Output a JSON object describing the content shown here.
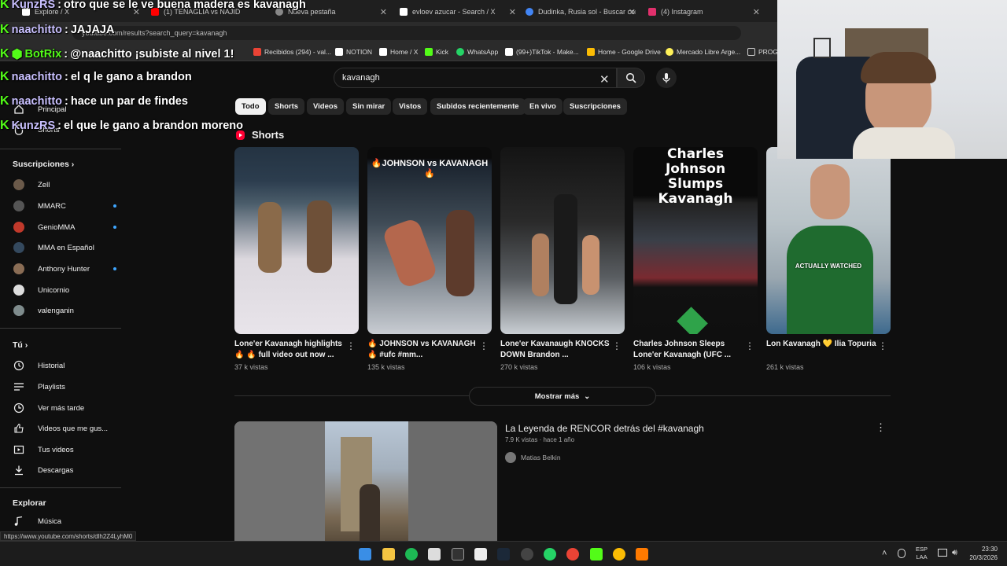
{
  "chat": [
    {
      "user": "KunzRS",
      "msg": "otro que se le ve buena madera es kavanagh"
    },
    {
      "user": "naachitto",
      "msg": "JAJAJA"
    },
    {
      "user": "BotRix",
      "msg": "@naachitto ¡subiste al nivel 1!"
    },
    {
      "user": "naachitto",
      "msg": "el q le gano a brandon"
    },
    {
      "user": "naachitto",
      "msg": "hace un par de findes"
    },
    {
      "user": "KunzRS",
      "msg": "el que le gano a brandon moreno"
    }
  ],
  "tabs": [
    {
      "label": "Explore / X",
      "color": "#ffffff"
    },
    {
      "label": "(1) TENAGLIA vs NAJID",
      "color": "#ff0000"
    },
    {
      "label": "Nueva pestaña",
      "color": "#888888"
    },
    {
      "label": "evloev azucar - Search / X",
      "color": "#ffffff"
    },
    {
      "label": "Dudinka, Rusia sol - Buscar con",
      "color": "#4285f4"
    },
    {
      "label": "(4) Instagram",
      "color": "#e1306c"
    }
  ],
  "address": "youtube.com/results?search_query=kavanagh",
  "bookmarks": [
    {
      "label": "Recibidos (294) - val...",
      "color": "#ea4335"
    },
    {
      "label": "NOTION",
      "color": "#ffffff"
    },
    {
      "label": "Home / X",
      "color": "#ffffff"
    },
    {
      "label": "Kick",
      "color": "#53fc18"
    },
    {
      "label": "WhatsApp",
      "color": "#25d366"
    },
    {
      "label": "(99+)TikTok - Make...",
      "color": "#ffffff"
    },
    {
      "label": "Home - Google Drive",
      "color": "#fbbc04"
    },
    {
      "label": "Mercado Libre Arge...",
      "color": "#fff159"
    },
    {
      "label": "PROG",
      "color": "#cccccc"
    }
  ],
  "search": {
    "value": "kavanagh"
  },
  "chips": [
    "Todo",
    "Shorts",
    "Videos",
    "Sin mirar",
    "Vistos",
    "Subidos recientemente",
    "En vivo",
    "Suscripciones"
  ],
  "sidebar": {
    "top": [
      {
        "label": "Principal"
      },
      {
        "label": "Shorts"
      }
    ],
    "subs_heading": "Suscripciones",
    "subs": [
      {
        "label": "Zell",
        "color": "#6b5a4a",
        "dot": false
      },
      {
        "label": "MMARC",
        "color": "#555555",
        "dot": true
      },
      {
        "label": "GenioMMA",
        "color": "#c0392b",
        "dot": true
      },
      {
        "label": "MMA en Español",
        "color": "#34495e",
        "dot": false
      },
      {
        "label": "Anthony Hunter",
        "color": "#8a6d55",
        "dot": true
      },
      {
        "label": "Unicornio",
        "color": "#dddddd",
        "dot": false
      },
      {
        "label": "valenganin",
        "color": "#7f8c8d",
        "dot": false
      }
    ],
    "you_heading": "Tú",
    "you": [
      {
        "label": "Historial",
        "icon": "history-icon"
      },
      {
        "label": "Playlists",
        "icon": "playlist-icon"
      },
      {
        "label": "Ver más tarde",
        "icon": "clock-icon"
      },
      {
        "label": "Videos que me gus...",
        "icon": "thumbs-up-icon"
      },
      {
        "label": "Tus videos",
        "icon": "video-icon"
      },
      {
        "label": "Descargas",
        "icon": "download-icon"
      }
    ],
    "explore_heading": "Explorar",
    "explore": [
      {
        "label": "Música",
        "icon": "music-icon"
      }
    ]
  },
  "shorts_heading": "Shorts",
  "shorts": [
    {
      "title": "Lone'er Kavanagh highlights 🔥 🔥 full video out now ...",
      "views": "37 k vistas",
      "overlay": ""
    },
    {
      "title": "🔥 JOHNSON vs KAVANAGH 🔥 #ufc #mm...",
      "views": "135 k vistas",
      "overlay": "🔥JOHNSON vs KAVANAGH🔥"
    },
    {
      "title": "Lone'er Kavanaugh KNOCKS DOWN Brandon ...",
      "views": "270 k vistas",
      "overlay": ""
    },
    {
      "title": "Charles Johnson Sleeps Lone'er Kavanagh (UFC ...",
      "views": "106 k vistas",
      "overlay": "Charles Johnson Slumps Kavanagh"
    },
    {
      "title": "Lon Kavanagh 💛 Ilia Topuria",
      "views": "261 k vistas",
      "overlay": "ACTUALLY WATCHED"
    }
  ],
  "show_more": "Mostrar más",
  "video": {
    "title": "La Leyenda de RENCOR detrás del #kavanagh",
    "meta": "7.9 K vistas · hace 1 año",
    "channel": "Matias Belkin"
  },
  "status_url": "https://www.youtube.com/shorts/dlh2Z4LyhM0",
  "clock": {
    "time": "23:30",
    "date": "20/3/2026",
    "lang1": "ESP",
    "lang2": "LAA"
  }
}
